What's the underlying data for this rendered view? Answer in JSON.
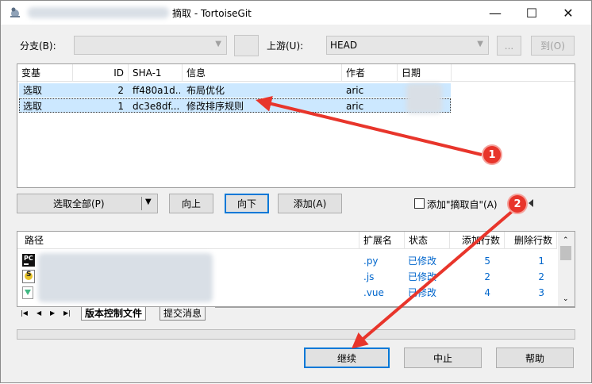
{
  "title": "摘取 - TortoiseGit",
  "window": {
    "minimize": "—",
    "maximize": "☐",
    "close": "✕"
  },
  "branch": {
    "label": "分支(B):",
    "value": ""
  },
  "upstream": {
    "label": "上游(U):",
    "value": "HEAD",
    "browse": "...",
    "goto": "到(O)"
  },
  "commits": {
    "columns": [
      "变基",
      "ID",
      "SHA-1",
      "信息",
      "作者",
      "日期"
    ],
    "rows": [
      {
        "action": "选取",
        "id": "2",
        "sha": "ff480a1d...",
        "message": "布局优化",
        "author": "aric"
      },
      {
        "action": "选取",
        "id": "1",
        "sha": "dc3e8df...",
        "message": "修改排序规则",
        "author": "aric"
      }
    ]
  },
  "controls": {
    "select_all": "选取全部(P)",
    "up": "向上",
    "down": "向下",
    "add": "添加(A)",
    "add_from_label": "添加\"摘取自\"(A)"
  },
  "files": {
    "columns": [
      "路径",
      "扩展名",
      "状态",
      "添加行数",
      "删除行数"
    ],
    "rows": [
      {
        "icon": "pycharm-icon",
        "ext": ".py",
        "status": "已修改",
        "added": "5",
        "deleted": "1"
      },
      {
        "icon": "js-file-icon",
        "ext": ".js",
        "status": "已修改",
        "added": "2",
        "deleted": "2"
      },
      {
        "icon": "vue-file-icon",
        "ext": ".vue",
        "status": "已修改",
        "added": "4",
        "deleted": "3"
      }
    ]
  },
  "tabs": {
    "files": "版本控制文件",
    "message": "提交消息"
  },
  "actions": {
    "continue": "继续",
    "abort": "中止",
    "help": "帮助"
  },
  "markers": {
    "one": "1",
    "two": "2"
  },
  "colors": {
    "selection": "#cce8ff",
    "arrow": "#e8352b",
    "link": "#0066cc",
    "focus": "#0078d7"
  }
}
